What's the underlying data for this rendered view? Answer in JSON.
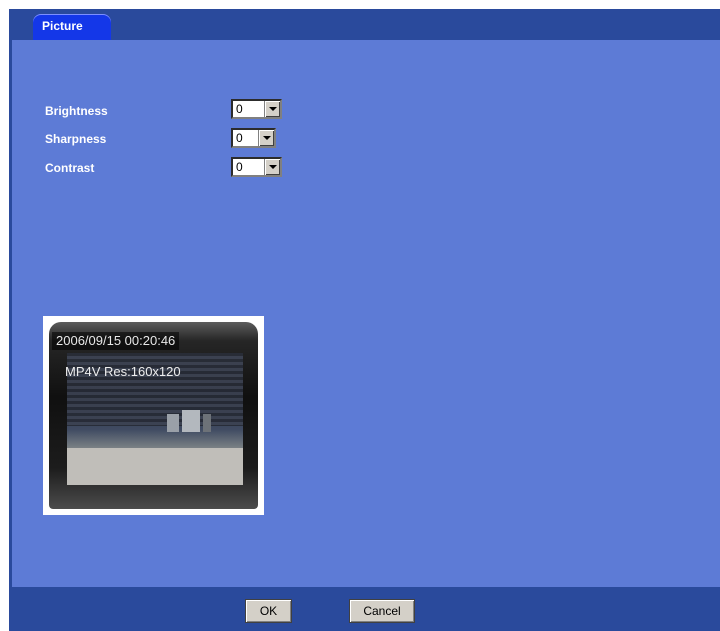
{
  "tabs": [
    {
      "label": "Picture",
      "active": true
    }
  ],
  "settings": [
    {
      "label": "Brightness",
      "value": "0"
    },
    {
      "label": "Sharpness",
      "value": "0"
    },
    {
      "label": "Contrast",
      "value": "0"
    }
  ],
  "preview": {
    "timestamp": "2006/09/15 00:20:46",
    "overlay": "MP4V Res:160x120"
  },
  "buttons": {
    "ok": "OK",
    "cancel": "Cancel"
  },
  "colors": {
    "panel": "#5d7bd6",
    "header": "#2a4a9c",
    "tab": "#1437e8",
    "label_text": "#ffffff"
  }
}
